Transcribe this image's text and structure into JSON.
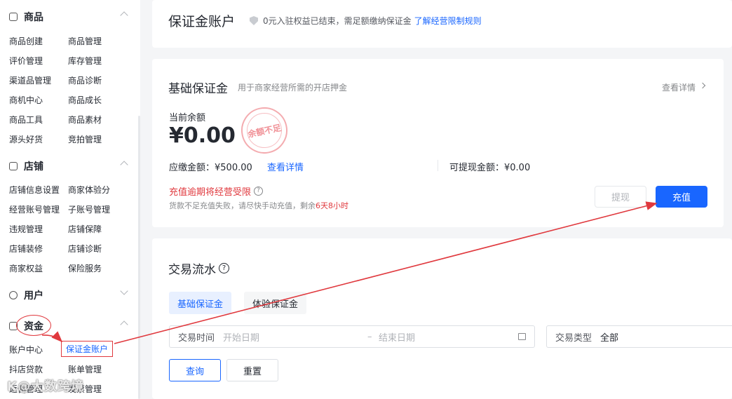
{
  "sidebar": {
    "sections": [
      {
        "title": "商品",
        "items": [
          "商品创建",
          "商品管理",
          "评价管理",
          "库存管理",
          "渠道品管理",
          "商品诊断",
          "商机中心",
          "商品成长",
          "商品工具",
          "商品素材",
          "源头好货",
          "竞拍管理"
        ]
      },
      {
        "title": "店铺",
        "items": [
          "店铺信息设置",
          "商家体验分",
          "经营账号管理",
          "子账号管理",
          "违规管理",
          "店铺保障",
          "店铺装修",
          "店铺诊断",
          "商家权益",
          "保险服务"
        ]
      },
      {
        "title": "用户",
        "items": []
      },
      {
        "title": "资金",
        "items": [
          "账户中心",
          "保证金账户",
          "抖店贷款",
          "账单管理",
          "返佣管理",
          "发票管理"
        ]
      }
    ]
  },
  "header": {
    "title": "保证金账户",
    "notice": "0元入驻权益已结束，需足额缴纳保证金",
    "notice_link": "了解经营限制规则"
  },
  "basic": {
    "title": "基础保证金",
    "subtitle": "用于商家经营所需的开店押金",
    "detail_link": "查看详情",
    "balance_label": "当前余额",
    "balance_value": "¥0.00",
    "stamp_text": "余额不足",
    "due_label": "应缴金额：¥500.00",
    "due_link": "查看详情",
    "withdrawable": "可提现金额：¥0.00",
    "warning_title": "充值逾期将经营受限",
    "warning_desc_prefix": "货款不足充值失败，请尽快手动充值，剩余",
    "warning_desc_time": "6天8小时",
    "withdraw_button": "提现",
    "recharge_button": "充值"
  },
  "flow": {
    "title": "交易流水",
    "tabs": [
      "基础保证金",
      "体验保证金"
    ],
    "time_label": "交易时间",
    "start_placeholder": "开始日期",
    "range_sep": "–",
    "end_placeholder": "结束日期",
    "type_label": "交易类型",
    "type_value": "全部",
    "query_button": "查询",
    "reset_button": "重置"
  },
  "watermark": "K@大数跨境",
  "colors": {
    "primary": "#1966ff",
    "danger": "#e0393e",
    "annotation": "#e0393e"
  }
}
